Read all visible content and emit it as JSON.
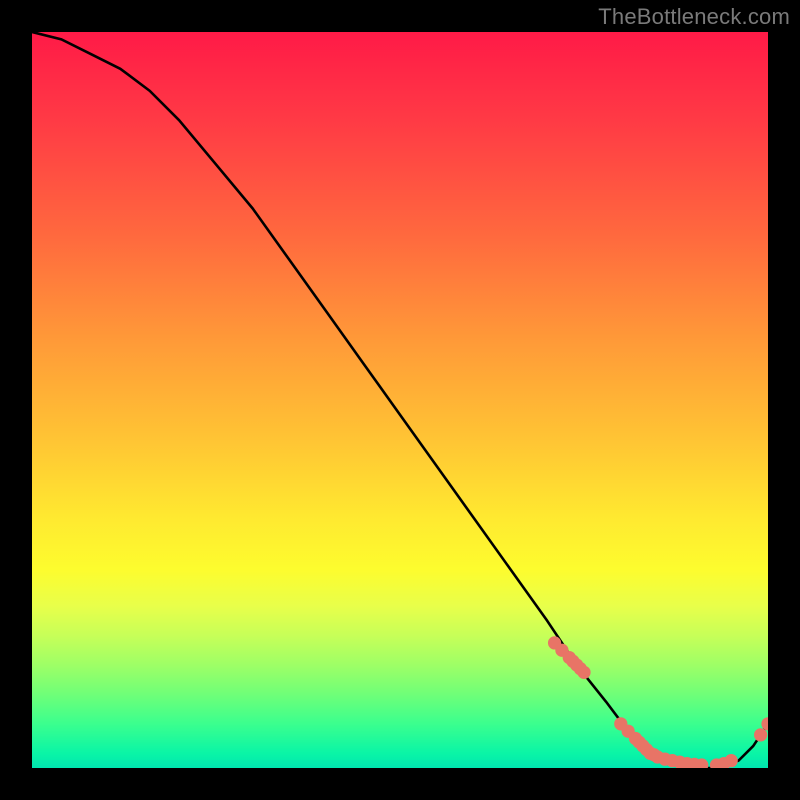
{
  "watermark": "TheBottleneck.com",
  "chart_data": {
    "type": "line",
    "title": "",
    "xlabel": "",
    "ylabel": "",
    "xlim": [
      0,
      100
    ],
    "ylim": [
      0,
      100
    ],
    "grid": false,
    "legend": false,
    "background_gradient": {
      "top_color": "#ff1a47",
      "bottom_color": "#00e6b0",
      "meaning": "red high to green low (bottleneck severity)"
    },
    "series": [
      {
        "name": "bottleneck-curve",
        "type": "line",
        "color": "#000000",
        "x": [
          0,
          4,
          8,
          12,
          16,
          20,
          25,
          30,
          35,
          40,
          45,
          50,
          55,
          60,
          65,
          70,
          74,
          78,
          81,
          84,
          87,
          90,
          93,
          96,
          98,
          100
        ],
        "y": [
          100,
          99,
          97,
          95,
          92,
          88,
          82,
          76,
          69,
          62,
          55,
          48,
          41,
          34,
          27,
          20,
          14,
          9,
          5,
          2,
          1,
          0,
          0,
          1,
          3,
          6
        ]
      },
      {
        "name": "highlight-points",
        "type": "scatter",
        "color": "#e87466",
        "x": [
          71,
          72,
          73,
          73.5,
          74,
          74.5,
          75,
          80,
          81,
          82,
          82.5,
          83,
          83.5,
          84,
          84.5,
          85,
          86,
          87,
          88,
          89,
          90,
          91,
          93,
          94,
          95,
          99,
          100
        ],
        "y": [
          17,
          16,
          15,
          14.5,
          14,
          13.5,
          13,
          6,
          5,
          4,
          3.5,
          3,
          2.5,
          2,
          1.8,
          1.5,
          1.2,
          1,
          0.8,
          0.6,
          0.5,
          0.4,
          0.4,
          0.6,
          1,
          4.5,
          6
        ]
      }
    ]
  }
}
